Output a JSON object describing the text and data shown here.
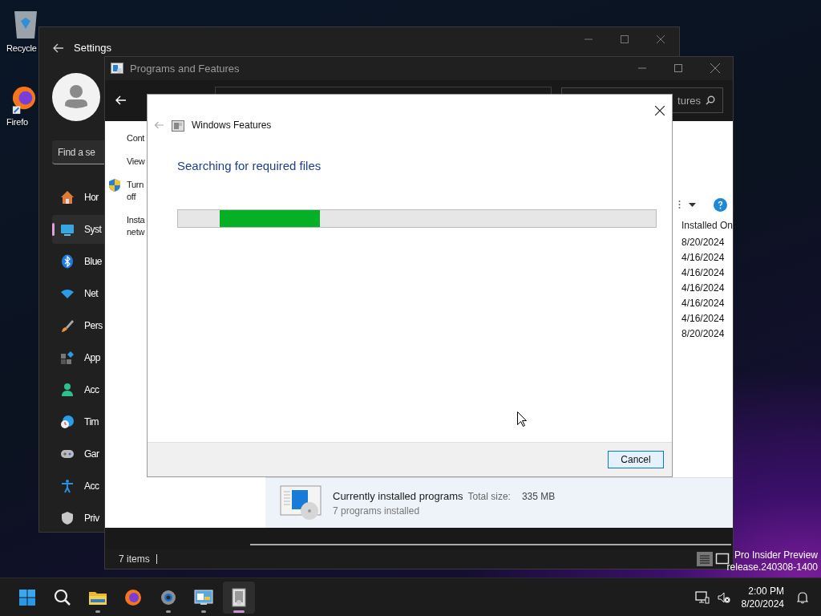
{
  "desktop": {
    "icons": [
      {
        "kind": "recycle",
        "label": "Recycle"
      },
      {
        "kind": "firefox",
        "label": "Firefo"
      }
    ],
    "watermark": [
      "Pro Insider Preview",
      "release.240308-1400"
    ]
  },
  "settings": {
    "title": "Settings",
    "search": {
      "placeholder": "Find a se"
    },
    "nav": [
      {
        "kind": "home",
        "label": "Hor",
        "selected": false
      },
      {
        "kind": "system",
        "label": "Syst",
        "selected": true
      },
      {
        "kind": "bluetooth",
        "label": "Blue",
        "selected": false
      },
      {
        "kind": "network",
        "label": "Net",
        "selected": false
      },
      {
        "kind": "brush",
        "label": "Pers",
        "selected": false
      },
      {
        "kind": "apps",
        "label": "App",
        "selected": false
      },
      {
        "kind": "account",
        "label": "Acc",
        "selected": false
      },
      {
        "kind": "time",
        "label": "Tim",
        "selected": false
      },
      {
        "kind": "gaming",
        "label": "Gar",
        "selected": false
      },
      {
        "kind": "accessibility",
        "label": "Acc",
        "selected": false
      },
      {
        "kind": "privacy",
        "label": "Priv",
        "selected": false
      }
    ]
  },
  "programs": {
    "title": "Programs and Features",
    "search": {
      "placeholder": "tures"
    },
    "left_pane": [
      {
        "kind": "plain",
        "text": "Cont"
      },
      {
        "kind": "plain",
        "text": "View"
      },
      {
        "kind": "shield",
        "text": "Turn off"
      },
      {
        "kind": "plain",
        "text": "Insta netw"
      }
    ],
    "table": {
      "columns": [
        "Installed On"
      ],
      "rows": [
        [
          "8/20/2024"
        ],
        [
          "4/16/2024"
        ],
        [
          "4/16/2024"
        ],
        [
          "4/16/2024"
        ],
        [
          "4/16/2024"
        ],
        [
          "4/16/2024"
        ],
        [
          "8/20/2024"
        ]
      ]
    },
    "details": {
      "title": "Currently installed programs",
      "total_size_label": "Total size:",
      "total_size": "335 MB",
      "count": "7 programs installed"
    },
    "status_bar": {
      "items": "7 items"
    }
  },
  "dialog": {
    "title": "Windows Features",
    "heading": "Searching for required files",
    "progress": {
      "level": 0.21
    },
    "buttons": [
      "Cancel"
    ]
  },
  "taskbar": {
    "apps": [
      {
        "kind": "start",
        "running": false,
        "selected": false
      },
      {
        "kind": "search",
        "running": false,
        "selected": false
      },
      {
        "kind": "folder",
        "running": true,
        "selected": false
      },
      {
        "kind": "firefox",
        "running": false,
        "selected": false
      },
      {
        "kind": "settings",
        "running": true,
        "selected": false
      },
      {
        "kind": "control",
        "running": true,
        "selected": false
      },
      {
        "kind": "installer",
        "running": true,
        "selected": true
      }
    ],
    "time": "2:00 PM",
    "date": "8/20/2024"
  }
}
